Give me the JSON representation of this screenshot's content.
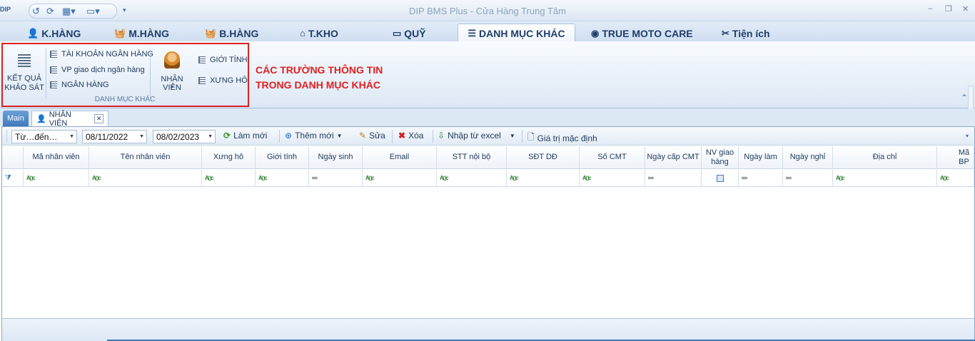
{
  "app": {
    "logo_text": "DIP",
    "title": "DIP BMS Plus - Cửa Hàng Trung Tâm",
    "min": "–",
    "restore": "❐",
    "close": "✕"
  },
  "qat": {
    "undo": "↺",
    "refresh": "⟳",
    "grid": "▦▾",
    "layout": "▭▾",
    "more": "▾"
  },
  "tabs": [
    {
      "label": "K.HÀNG",
      "icon": "person-icon"
    },
    {
      "label": "M.HÀNG",
      "icon": "basket-icon"
    },
    {
      "label": "B.HÀNG",
      "icon": "basket-icon"
    },
    {
      "label": "T.KHO",
      "icon": "warehouse-icon"
    },
    {
      "label": "QUỸ",
      "icon": "money-icon"
    },
    {
      "label": "DANH MỤC KHÁC",
      "icon": "list-icon",
      "active": true
    },
    {
      "label": "TRUE MOTO CARE",
      "icon": "moto-icon"
    },
    {
      "label": "Tiện ích",
      "icon": "tools-icon"
    }
  ],
  "ribbon": {
    "ket_qua_1": "KẾT QUẢ",
    "ket_qua_2": "KHẢO SÁT",
    "tk_ngan_hang": "TÀI KHOẢN NGÂN HÀNG",
    "vp_giao_dich": "VP giao dịch ngân hàng",
    "ngan_hang": "NGÂN HÀNG",
    "nhan_vien": "NHÂN VIÊN",
    "gioi_tinh": "GIỚI TÍNH",
    "xung_ho": "XƯNG HÔ",
    "group_label": "DANH MỤC KHÁC"
  },
  "annotation": {
    "line1": "CÁC TRƯỜNG THÔNG TIN",
    "line2": "TRONG DANH MỤC KHÁC"
  },
  "doc_tabs": {
    "main": "Main",
    "nhan_vien": "NHÂN VIÊN"
  },
  "toolbar": {
    "period": "Từ…đến…",
    "from_date": "08/11/2022",
    "to_date": "08/02/2023",
    "refresh": "Làm mới",
    "add": "Thêm mới",
    "edit": "Sửa",
    "delete": "Xóa",
    "import": "Nhập từ excel",
    "default_value": "Giá trị mặc định"
  },
  "columns": [
    "Mã nhân viên",
    "Tên nhân viên",
    "Xưng hô",
    "Giới tính",
    "Ngày sinh",
    "Email",
    "STT nội bộ",
    "SĐT DĐ",
    "Số CMT",
    "Ngày cấp CMT",
    "NV giao hàng",
    "Ngày làm",
    "Ngày nghỉ",
    "Địa chỉ",
    "Mã BP"
  ],
  "filter_types": [
    "abc",
    "abc",
    "abc",
    "abc",
    "eq",
    "abc",
    "abc",
    "abc",
    "abc",
    "eq",
    "chk",
    "eq",
    "eq",
    "abc",
    "abc"
  ],
  "filter_abc_text": "A▯c",
  "filter_eq_text": "═"
}
